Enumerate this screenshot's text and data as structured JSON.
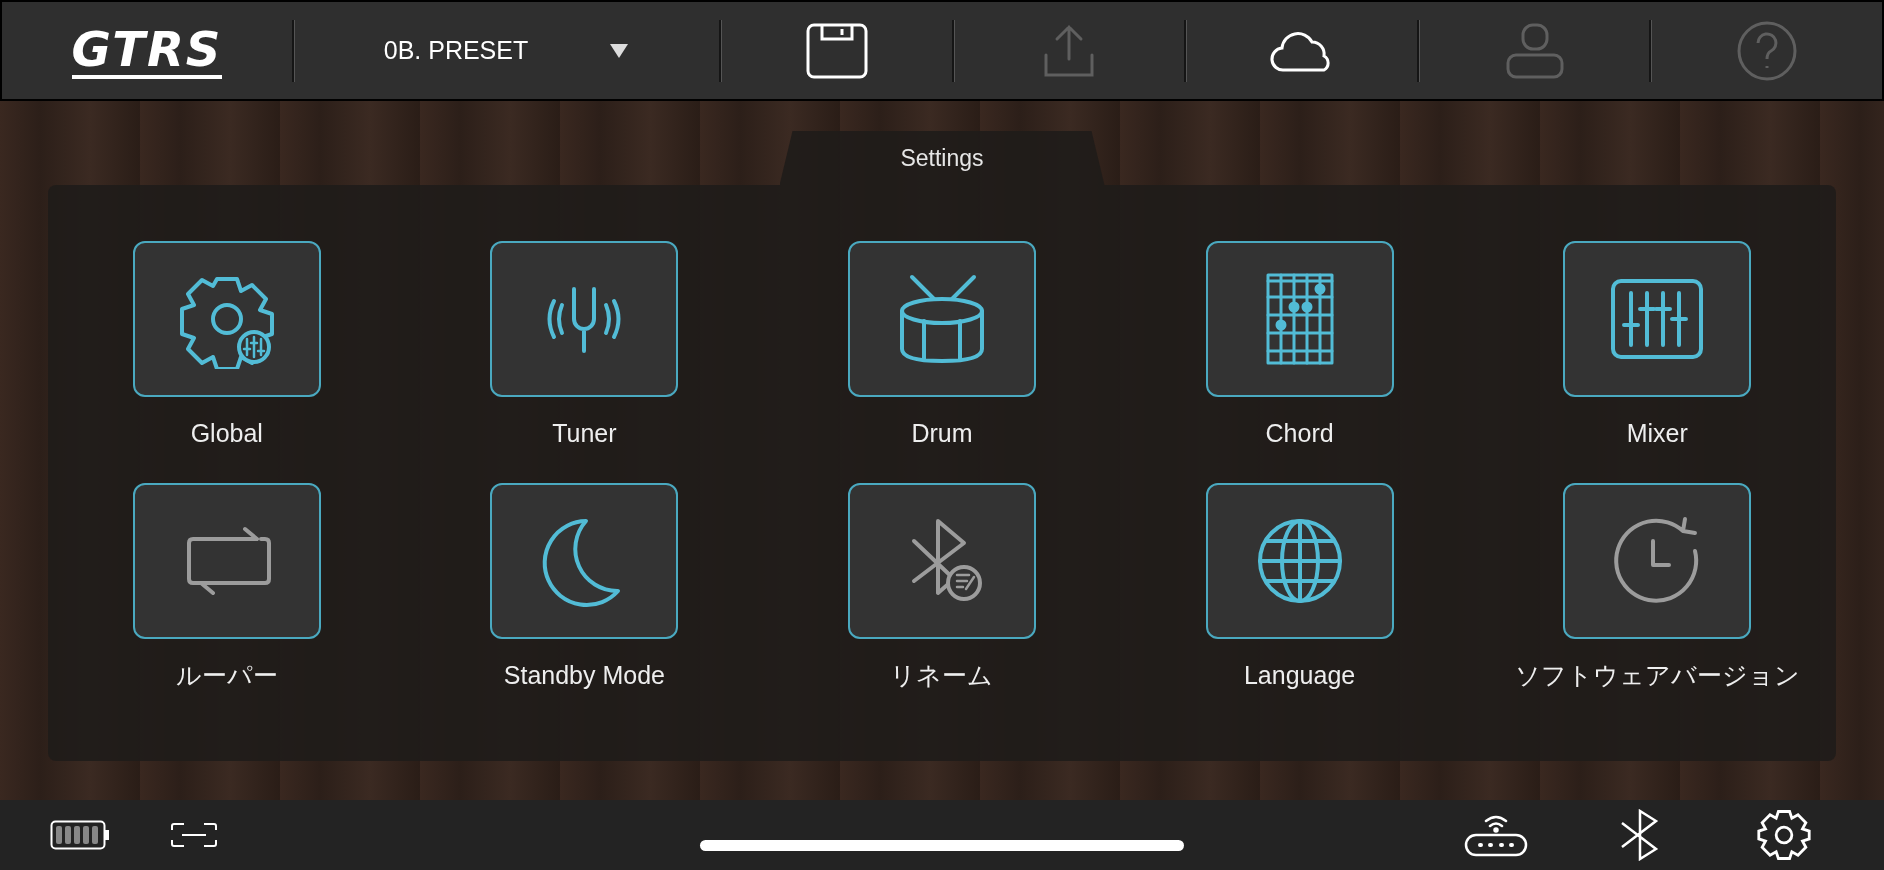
{
  "top_bar": {
    "logo": "GTRS",
    "preset": {
      "label": "0B. PRESET"
    },
    "tools": [
      {
        "kind": "save",
        "disabled": false
      },
      {
        "kind": "upload",
        "disabled": true
      },
      {
        "kind": "cloud",
        "disabled": false
      },
      {
        "kind": "account",
        "disabled": true
      },
      {
        "kind": "help",
        "disabled": true
      }
    ]
  },
  "panel": {
    "title": "Settings",
    "items": [
      {
        "label": "Global",
        "kind": "global",
        "enabled": true
      },
      {
        "label": "Tuner",
        "kind": "tuner",
        "enabled": true
      },
      {
        "label": "Drum",
        "kind": "drum",
        "enabled": true
      },
      {
        "label": "Chord",
        "kind": "chord",
        "enabled": true
      },
      {
        "label": "Mixer",
        "kind": "mixer",
        "enabled": true
      },
      {
        "label": "ルーパー",
        "kind": "looper",
        "enabled": false
      },
      {
        "label": "Standby Mode",
        "kind": "standby",
        "enabled": true
      },
      {
        "label": "リネーム",
        "kind": "rename",
        "enabled": false
      },
      {
        "label": "Language",
        "kind": "language",
        "enabled": true
      },
      {
        "label": "ソフトウェアバージョン",
        "kind": "version",
        "enabled": false
      }
    ]
  },
  "bottom_bar": {
    "left": [
      {
        "kind": "battery"
      },
      {
        "kind": "link"
      }
    ],
    "right": [
      {
        "kind": "router"
      },
      {
        "kind": "bluetooth"
      },
      {
        "kind": "settings"
      }
    ]
  }
}
